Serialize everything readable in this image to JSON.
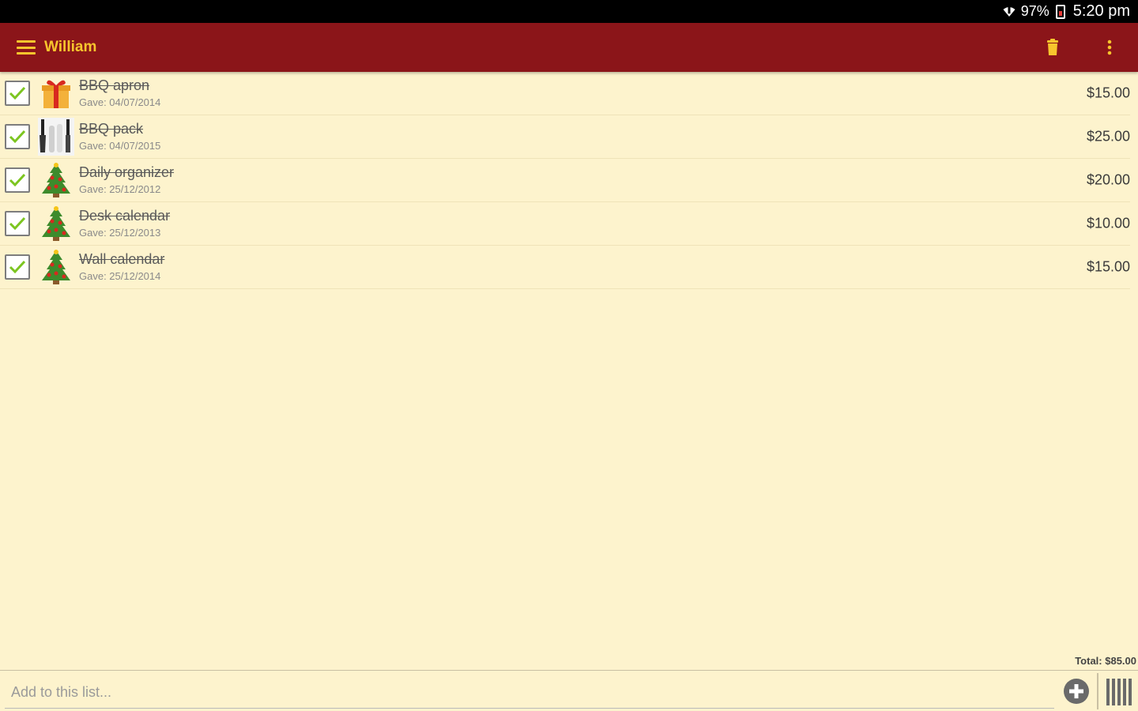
{
  "status_bar": {
    "battery": "97%",
    "time": "5:20 pm"
  },
  "app_bar": {
    "title": "William"
  },
  "items": [
    {
      "name": "BBQ apron",
      "date": "Gave: 04/07/2014",
      "price": "$15.00",
      "thumb": "gift-icon",
      "checked": true
    },
    {
      "name": "BBQ pack",
      "date": "Gave: 04/07/2015",
      "price": "$25.00",
      "thumb": "bbq-tools-thumb",
      "checked": true
    },
    {
      "name": "Daily organizer",
      "date": "Gave: 25/12/2012",
      "price": "$20.00",
      "thumb": "christmas-tree-icon",
      "checked": true
    },
    {
      "name": "Desk calendar",
      "date": "Gave: 25/12/2013",
      "price": "$10.00",
      "thumb": "christmas-tree-icon",
      "checked": true
    },
    {
      "name": "Wall calendar",
      "date": "Gave: 25/12/2014",
      "price": "$15.00",
      "thumb": "christmas-tree-icon",
      "checked": true
    }
  ],
  "footer": {
    "total": "Total: $85.00",
    "add_placeholder": "Add to this list..."
  },
  "colors": {
    "app_bar": "#8b1519",
    "accent": "#f7c52d",
    "background": "#fdf3cd",
    "check": "#7cc520"
  }
}
